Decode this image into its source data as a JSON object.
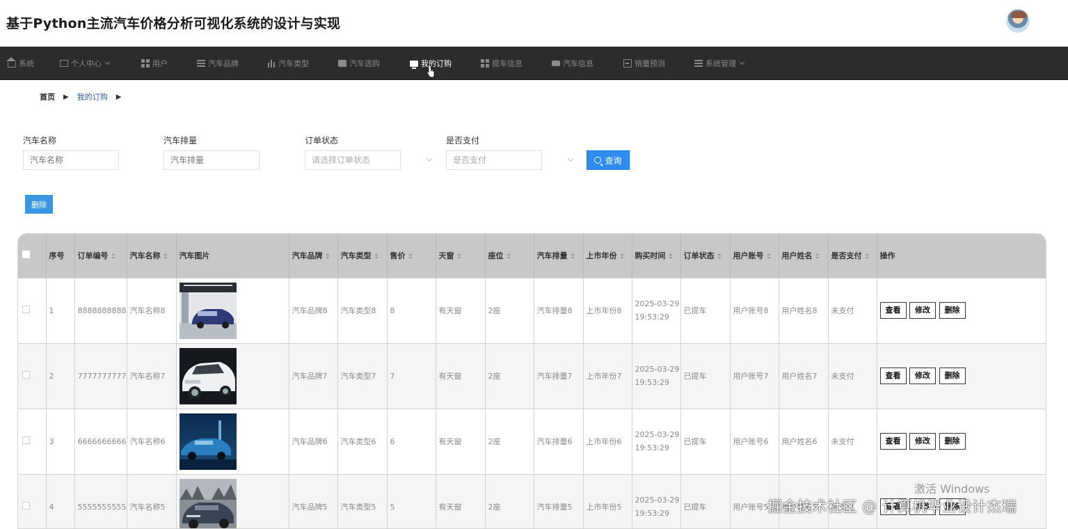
{
  "header": {
    "title": "基于Python主流汽车价格分析可视化系统的设计与实现"
  },
  "nav": {
    "items": [
      {
        "label": "系统",
        "icon": "home-icon"
      },
      {
        "label": "个人中心",
        "icon": "box-icon",
        "dropdown": true
      },
      {
        "label": "用户",
        "icon": "grid-icon"
      },
      {
        "label": "汽车品牌",
        "icon": "list-icon"
      },
      {
        "label": "汽车类型",
        "icon": "bar-chart-icon"
      },
      {
        "label": "汽车选购",
        "icon": "picture-icon"
      },
      {
        "label": "我的订购",
        "icon": "monitor-icon",
        "active": true
      },
      {
        "label": "提车信息",
        "icon": "grid-icon"
      },
      {
        "label": "汽车信息",
        "icon": "camera-icon"
      },
      {
        "label": "销量预测",
        "icon": "clipboard-icon"
      },
      {
        "label": "系统管理",
        "icon": "list-icon",
        "dropdown": true
      }
    ]
  },
  "breadcrumb": {
    "home": "首页",
    "current": "我的订购"
  },
  "filters": {
    "car_name": {
      "label": "汽车名称",
      "placeholder": "汽车名称"
    },
    "displacement": {
      "label": "汽车排量",
      "placeholder": "汽车排量"
    },
    "order_status": {
      "label": "订单状态",
      "placeholder": "请选择订单状态"
    },
    "paid": {
      "label": "是否支付",
      "placeholder": "是否支付"
    },
    "query_label": "查询"
  },
  "toolbar": {
    "delete_label": "删除"
  },
  "table": {
    "headers": [
      "序号",
      "订单编号",
      "汽车名称",
      "汽车图片",
      "汽车品牌",
      "汽车类型",
      "售价",
      "天窗",
      "座位",
      "汽车排量",
      "上市年份",
      "购买时间",
      "订单状态",
      "用户账号",
      "用户姓名",
      "是否支付",
      "操作"
    ],
    "rows": [
      {
        "idx": "1",
        "order_no": "8888888888",
        "name": "汽车名称8",
        "brand": "汽车品牌8",
        "type": "汽车类型8",
        "price": "8",
        "sunroof": "有天窗",
        "seats": "2座",
        "displacement": "汽车排量8",
        "year": "上市年份8",
        "time": "2025-03-29 19:53:29",
        "status": "已提车",
        "account": "用户账号8",
        "username": "用户姓名8",
        "paid": "未支付"
      },
      {
        "idx": "2",
        "order_no": "7777777777",
        "name": "汽车名称7",
        "brand": "汽车品牌7",
        "type": "汽车类型7",
        "price": "7",
        "sunroof": "有天窗",
        "seats": "2座",
        "displacement": "汽车排量7",
        "year": "上市年份7",
        "time": "2025-03-29 19:53:29",
        "status": "已提车",
        "account": "用户账号7",
        "username": "用户姓名7",
        "paid": "未支付"
      },
      {
        "idx": "3",
        "order_no": "6666666666",
        "name": "汽车名称6",
        "brand": "汽车品牌6",
        "type": "汽车类型6",
        "price": "6",
        "sunroof": "有天窗",
        "seats": "2座",
        "displacement": "汽车排量6",
        "year": "上市年份6",
        "time": "2025-03-29 19:53:29",
        "status": "已提车",
        "account": "用户账号6",
        "username": "用户姓名6",
        "paid": "未支付"
      },
      {
        "idx": "4",
        "order_no": "5555555555",
        "name": "汽车名称5",
        "brand": "汽车品牌5",
        "type": "汽车类型5",
        "price": "5",
        "sunroof": "有天窗",
        "seats": "2座",
        "displacement": "汽车排量5",
        "year": "上市年份5",
        "time": "2025-03-29 19:53:29",
        "status": "已提车",
        "account": "用户账号5",
        "username": "用户姓名5",
        "paid": "未支付"
      }
    ],
    "actions": {
      "view": "查看",
      "edit": "修改",
      "delete": "删除"
    }
  },
  "watermarks": {
    "windows": "激活 Windows",
    "site": "掘金技术社区 @ 计算机毕业设计杰瑞"
  }
}
